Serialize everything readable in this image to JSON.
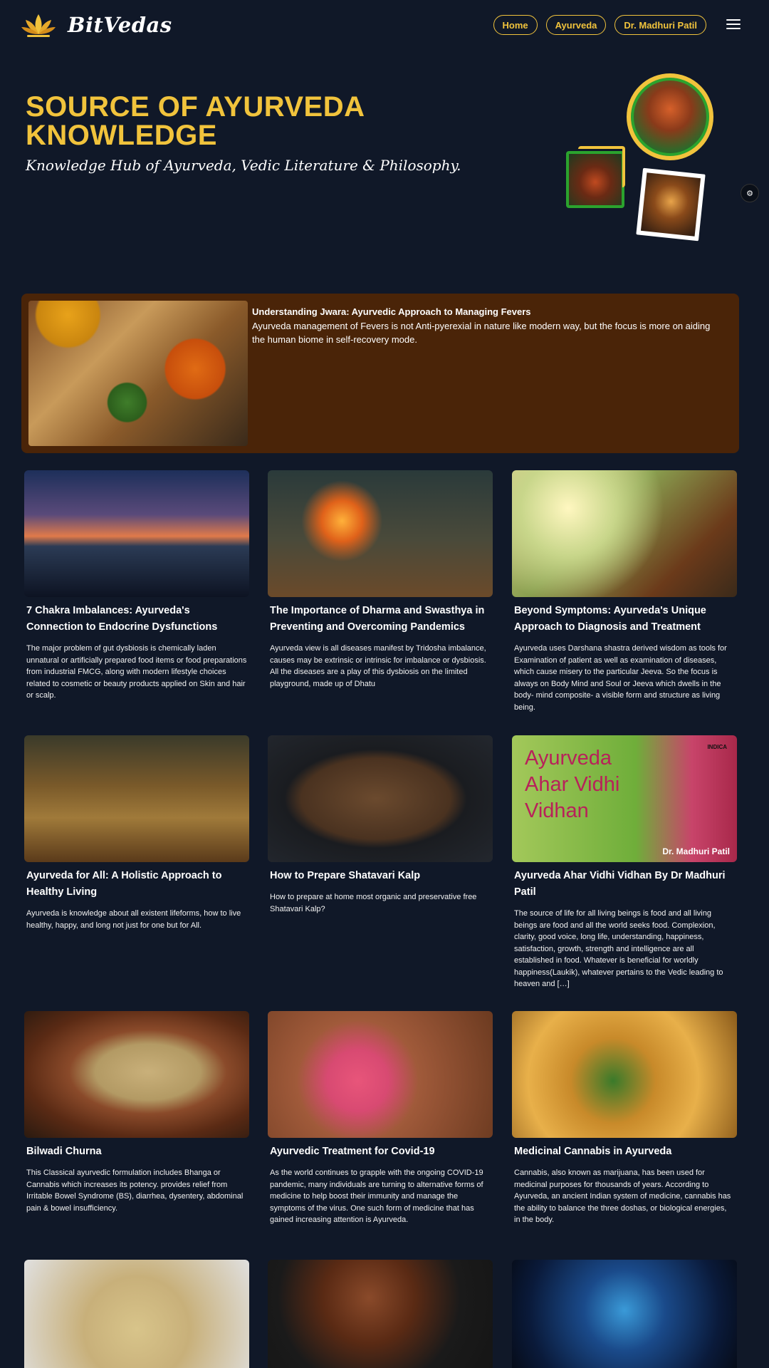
{
  "header": {
    "brand": "BitVedas",
    "nav": [
      {
        "label": "Home"
      },
      {
        "label": "Ayurveda"
      },
      {
        "label": "Dr. Madhuri Patil"
      }
    ],
    "menu_icon": "hamburger-menu-icon"
  },
  "hero": {
    "title": "SOURCE OF AYURVEDA KNOWLEDGE",
    "subtitle": "Knowledge Hub of Ayurveda, Vedic Literature & Philosophy."
  },
  "featured": {
    "title": "Understanding Jwara: Ayurvedic Approach to Managing Fevers",
    "excerpt": "Ayurveda management of Fevers is not Anti-pyerexial in nature like modern way, but the focus is more on aiding the human biome in self-recovery mode."
  },
  "side_widget": {
    "label": "⚙"
  },
  "posts": [
    {
      "title": "7 Chakra Imbalances: Ayurveda's Connection to Endocrine Dysfunctions",
      "excerpt": "The major problem of gut dysbiosis is chemically laden unnatural or artificially prepared food items or food preparations from industrial FMCG, along with modern lifestyle choices related to cosmetic or beauty products applied on Skin and hair or scalp."
    },
    {
      "title": "The Importance of Dharma and Swasthya in Preventing and Overcoming Pandemics",
      "excerpt": "Ayurveda view is all diseases manifest by Tridosha imbalance, causes may be extrinsic or intrinsic for imbalance or dysbiosis. All the diseases are a play of this dysbiosis on the limited playground, made up of Dhatu"
    },
    {
      "title": "Beyond Symptoms: Ayurveda's Unique Approach to Diagnosis and Treatment",
      "excerpt": "Ayurveda uses Darshana shastra derived wisdom as tools for Examination of patient as well as examination of diseases, which cause misery to the particular Jeeva. So the focus is always on Body Mind and Soul or Jeeva which dwells in the body- mind composite- a visible form and structure as living being."
    },
    {
      "title": "Ayurveda for All: A Holistic Approach to Healthy Living",
      "excerpt": "Ayurveda is knowledge about all existent lifeforms, how to live healthy, happy, and long not just for one but for All."
    },
    {
      "title": "How to Prepare Shatavari Kalp",
      "excerpt": "How to prepare at home most organic and preservative free Shatavari Kalp?"
    },
    {
      "title": "Ayurveda Ahar Vidhi Vidhan By Dr Madhuri Patil",
      "excerpt": "The source of life for all living beings is food and all living beings are food and all the world seeks food. Complexion, clarity, good voice, long life, understanding, happiness, satisfaction, growth, strength and intelligence are all established in food.  Whatever is beneficial for worldly happiness(Laukik),  whatever pertains to the Vedic leading to heaven and […]",
      "image_overlay": {
        "text": "Ayurveda Ahar Vidhi Vidhan",
        "name": "Dr. Madhuri Patil",
        "brand": "INDICA"
      }
    },
    {
      "title": "Bilwadi Churna",
      "excerpt": "This Classical ayurvedic formulation includes Bhanga or Cannabis which increases its potency. provides relief from Irritable Bowel Syndrome (BS), diarrhea, dysentery, abdominal pain & bowel insufficiency."
    },
    {
      "title": "Ayurvedic Treatment for Covid-19",
      "excerpt": "As the world continues to grapple with the ongoing COVID-19 pandemic, many individuals are turning to alternative forms of medicine to help boost their immunity and manage the symptoms of the virus. One such form of medicine that has gained increasing attention is Ayurveda."
    },
    {
      "title": "Medicinal Cannabis in Ayurveda",
      "excerpt": "Cannabis, also known as marijuana, has been used for medicinal purposes for thousands of years. According to Ayurveda, an ancient Indian system of medicine, cannabis has the ability to balance the three doshas, or biological energies, in the body."
    }
  ],
  "colors": {
    "background": "#101828",
    "accent": "#f1c33c",
    "featured_bg": "#4a2408"
  }
}
